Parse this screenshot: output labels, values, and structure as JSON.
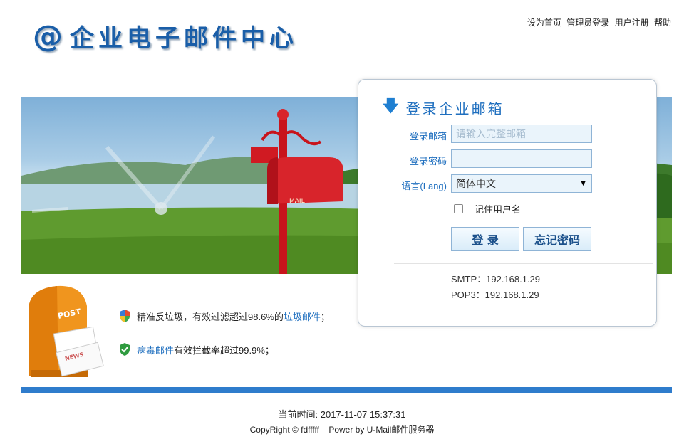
{
  "header": {
    "logo_at": "@",
    "logo_text": "企业电子邮件中心",
    "links": [
      "设为首页",
      "管理员登录",
      "用户注册",
      "帮助"
    ]
  },
  "login": {
    "title": "登录企业邮箱",
    "email_label": "登录邮箱",
    "email_placeholder": "请输入完整邮箱",
    "email_value": "",
    "password_label": "登录密码",
    "password_value": "",
    "lang_label": "语言(Lang)",
    "lang_selected": "简体中文",
    "remember_label": "记住用户名",
    "remember_checked": false,
    "login_button": "登 录",
    "forgot_button": "忘记密码",
    "smtp": "SMTP：192.168.1.29",
    "pop3": "POP3：192.168.1.29"
  },
  "banner": {
    "mailbox_label": "MAIL"
  },
  "promo": {
    "post_label": "POST",
    "news_label": "NEWS"
  },
  "features": [
    {
      "pre": "精准反垃圾，有效过滤超过98.6%的",
      "highlight": "垃圾邮件",
      "post": "；"
    },
    {
      "pre": "",
      "highlight": "病毒邮件",
      "post": "有效拦截率超过99.9%；"
    }
  ],
  "footer": {
    "time_label": "当前时间: ",
    "time_value": "2017-11-07 15:37:31",
    "copyright": "CopyRight © fdfffff    Power by U-Mail邮件服务器"
  },
  "colors": {
    "accent": "#1f6fbf",
    "bar": "#2f7ccc"
  }
}
